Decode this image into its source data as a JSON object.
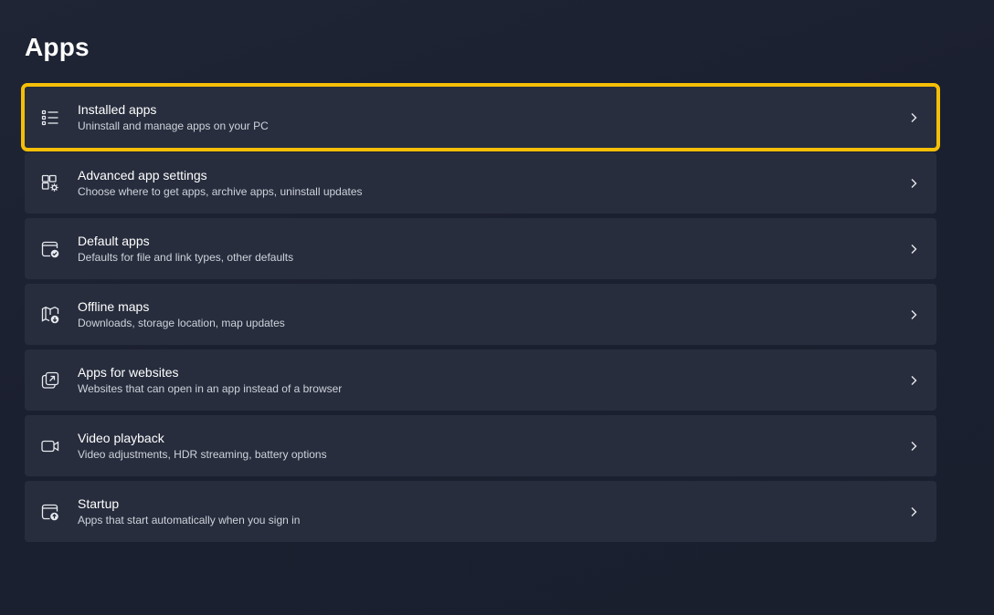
{
  "page": {
    "title": "Apps"
  },
  "colors": {
    "highlight": "#f5bf08",
    "row_background": "#272d3d",
    "page_background": "#1d2233"
  },
  "items": [
    {
      "title": "Installed apps",
      "subtitle": "Uninstall and manage apps on your PC",
      "icon": "list-icon",
      "highlighted": true
    },
    {
      "title": "Advanced app settings",
      "subtitle": "Choose where to get apps, archive apps, uninstall updates",
      "icon": "app-settings-icon",
      "highlighted": false
    },
    {
      "title": "Default apps",
      "subtitle": "Defaults for file and link types, other defaults",
      "icon": "default-apps-icon",
      "highlighted": false
    },
    {
      "title": "Offline maps",
      "subtitle": "Downloads, storage location, map updates",
      "icon": "map-download-icon",
      "highlighted": false
    },
    {
      "title": "Apps for websites",
      "subtitle": "Websites that can open in an app instead of a browser",
      "icon": "open-in-app-icon",
      "highlighted": false
    },
    {
      "title": "Video playback",
      "subtitle": "Video adjustments, HDR streaming, battery options",
      "icon": "video-camera-icon",
      "highlighted": false
    },
    {
      "title": "Startup",
      "subtitle": "Apps that start automatically when you sign in",
      "icon": "startup-icon",
      "highlighted": false
    }
  ]
}
